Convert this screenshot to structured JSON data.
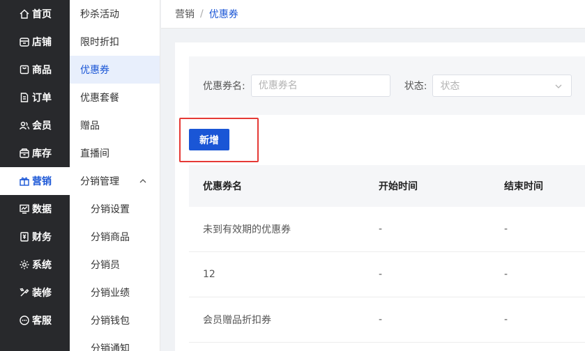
{
  "nav": {
    "items": [
      {
        "label": "首页",
        "icon": "home-icon"
      },
      {
        "label": "店铺",
        "icon": "store-icon"
      },
      {
        "label": "商品",
        "icon": "product-icon"
      },
      {
        "label": "订单",
        "icon": "order-icon"
      },
      {
        "label": "会员",
        "icon": "members-icon"
      },
      {
        "label": "库存",
        "icon": "inventory-icon"
      },
      {
        "label": "营销",
        "icon": "gift-icon",
        "active": true
      },
      {
        "label": "数据",
        "icon": "chart-icon"
      },
      {
        "label": "财务",
        "icon": "finance-icon"
      },
      {
        "label": "系统",
        "icon": "gear-icon"
      },
      {
        "label": "装修",
        "icon": "decorate-icon"
      },
      {
        "label": "客服",
        "icon": "chat-icon"
      }
    ]
  },
  "subnav": {
    "items": [
      {
        "label": "秒杀活动"
      },
      {
        "label": "限时折扣"
      },
      {
        "label": "优惠券",
        "active": true
      },
      {
        "label": "优惠套餐"
      },
      {
        "label": "赠品"
      },
      {
        "label": "直播间"
      },
      {
        "label": "分销管理",
        "expanded": true
      },
      {
        "label": "分销设置",
        "child": true
      },
      {
        "label": "分销商品",
        "child": true
      },
      {
        "label": "分销员",
        "child": true
      },
      {
        "label": "分销业绩",
        "child": true
      },
      {
        "label": "分销钱包",
        "child": true
      },
      {
        "label": "分销通知",
        "child": true
      }
    ]
  },
  "breadcrumb": {
    "parent": "营销",
    "separator": "/",
    "current": "优惠券"
  },
  "filter": {
    "name_label": "优惠券名:",
    "name_placeholder": "优惠券名",
    "status_label": "状态:",
    "status_placeholder": "状态"
  },
  "actions": {
    "add_label": "新增"
  },
  "table": {
    "columns": [
      "优惠券名",
      "开始时间",
      "结束时间"
    ],
    "rows": [
      [
        "未到有效期的优惠券",
        "-",
        "-"
      ],
      [
        "12",
        "-",
        "-"
      ],
      [
        "会员赠品折扣券",
        "-",
        "-"
      ]
    ]
  },
  "colors": {
    "primary": "#1a56d6",
    "nav_bg": "#28292c",
    "highlight": "#e53935"
  }
}
